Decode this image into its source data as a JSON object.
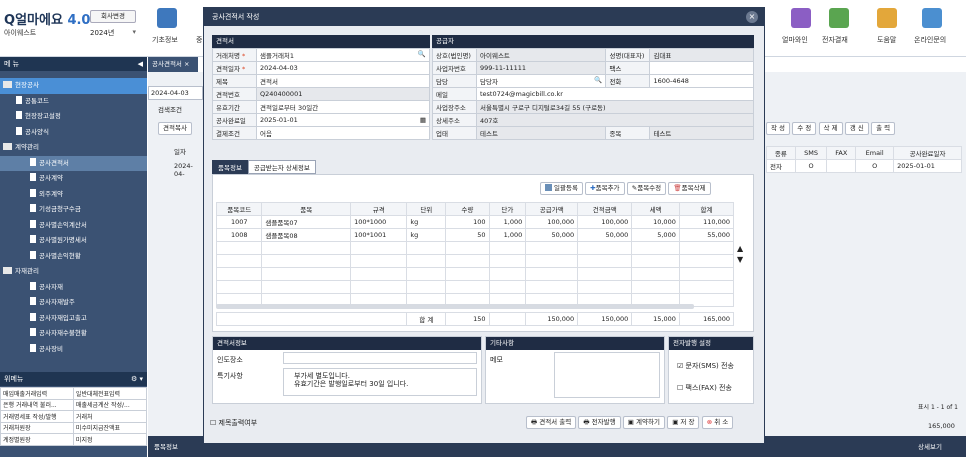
{
  "app": {
    "logo": "얼마에요",
    "version": "4.0",
    "company_btn": "회사변경",
    "company": "아이웨스트",
    "year": "2024년"
  },
  "toolbar": [
    "기초정보",
    "중",
    "얼마와인",
    "전자결재",
    "도움말",
    "온라인문의"
  ],
  "sidebar": {
    "title": "메 뉴",
    "items": [
      {
        "label": "현장공사",
        "level": "cat",
        "state": "sel"
      },
      {
        "label": "공통코드",
        "level": "sub"
      },
      {
        "label": "현장장고설정",
        "level": "sub"
      },
      {
        "label": "공사양식",
        "level": "sub"
      },
      {
        "label": "계약관리",
        "level": "cat"
      },
      {
        "label": "공사견적서",
        "level": "sub2",
        "state": "sel2"
      },
      {
        "label": "공사계약",
        "level": "sub2"
      },
      {
        "label": "외주계약",
        "level": "sub2"
      },
      {
        "label": "기성금청구수금",
        "level": "sub2"
      },
      {
        "label": "공사별손익계산서",
        "level": "sub2"
      },
      {
        "label": "공사별원가명세서",
        "level": "sub2"
      },
      {
        "label": "공사별손익현황",
        "level": "sub2"
      },
      {
        "label": "자재관리",
        "level": "cat"
      },
      {
        "label": "공사자재",
        "level": "sub2"
      },
      {
        "label": "공사자재발주",
        "level": "sub2"
      },
      {
        "label": "공사자재입고출고",
        "level": "sub2"
      },
      {
        "label": "공사자재수불현황",
        "level": "sub2"
      },
      {
        "label": "공사장비",
        "level": "sub2"
      }
    ],
    "fav_title": "위메뉴",
    "fav": [
      [
        "매입매출거래입력",
        "일반대체전표입력"
      ],
      [
        "은행 거래내역 불러...",
        "매출세금계산 작성/..."
      ],
      [
        "거래명세표 작성/발행",
        "거래처"
      ],
      [
        "거래처원장",
        "미수미지급잔액표"
      ],
      [
        "계정별원장",
        "미지정"
      ]
    ]
  },
  "background": {
    "tab": "공사견적서",
    "date": "2024-04-03",
    "search": "검색조건",
    "btn_print": "견적복사",
    "col_date": "일자",
    "row_date": "2024-04-",
    "cols": [
      "종류",
      "SMS",
      "FAX",
      "Email",
      "공사완료일자"
    ],
    "row": [
      "전자",
      "O",
      "",
      "O",
      "2025-01-01"
    ],
    "pager": "표시 1 - 1 of 1",
    "total": "165,000",
    "detail": "상세보기",
    "bottom_tab": "품목정보",
    "actions": [
      "작 성",
      "수 정",
      "삭 제",
      "갱 신",
      "출 력"
    ]
  },
  "modal": {
    "title": "공사견적서 작성",
    "estimate": {
      "title": "견적서",
      "rows": [
        {
          "label": "거래처명",
          "req": true,
          "value": "샘플거래처1"
        },
        {
          "label": "견적일자",
          "req": true,
          "value": "2024-04-03"
        },
        {
          "label": "제목",
          "value": "견적서"
        },
        {
          "label": "견적번호",
          "value": "Q240400001"
        },
        {
          "label": "유효기간",
          "value": "견적일로부터 30일간"
        },
        {
          "label": "공사완료일",
          "value": "2025-01-01"
        },
        {
          "label": "결제조건",
          "value": "어음"
        }
      ]
    },
    "supplier": {
      "title": "공급자",
      "biz_label": "상호(법인명)",
      "biz": "아이웨스트",
      "ceo_label": "성명(대표자)",
      "ceo": "김대표",
      "regno_label": "사업자번호",
      "regno": "999-11-11111",
      "fax_label": "팩스",
      "fax": "",
      "manager_label": "담당",
      "manager": "담당자",
      "tel_label": "전화",
      "tel": "1600-4648",
      "mail_label": "메일",
      "mail": "test0724@magicbill.co.kr",
      "addr_label": "사업장주소",
      "addr": "서울특별시 구로구 디지털로34길 55 (구로동)",
      "addr2_label": "상세주소",
      "addr2": "407호",
      "type_label": "업태",
      "type": "테스트",
      "item_label": "종목",
      "item": "테스트"
    },
    "tabs": [
      "품목정보",
      "공급받는자 상세정보"
    ],
    "item_buttons": [
      "일괄등록",
      "품목추가",
      "품목수정",
      "품목삭제"
    ],
    "grid": {
      "headers": [
        "품목코드",
        "품목",
        "규격",
        "단위",
        "수량",
        "단가",
        "공급가액",
        "건적금액",
        "세액",
        "합계"
      ],
      "rows": [
        [
          "1007",
          "샘플품목07",
          "100*1000",
          "kg",
          "100",
          "1,000",
          "100,000",
          "100,000",
          "10,000",
          "110,000"
        ],
        [
          "1008",
          "샘플품목08",
          "100*1001",
          "kg",
          "50",
          "1,000",
          "50,000",
          "50,000",
          "5,000",
          "55,000"
        ]
      ],
      "total_label": "합 계",
      "totals": [
        "150",
        "",
        "150,000",
        "150,000",
        "15,000",
        "165,000"
      ]
    },
    "info": {
      "title": "견적서정보",
      "place_label": "인도장소",
      "place": "",
      "note_label": "특기사항",
      "note1": "부가세 별도입니다.",
      "note2": "유효기간은 발행일로부터 30일 입니다."
    },
    "etc": {
      "title": "기타사항",
      "memo_label": "메모"
    },
    "send": {
      "title": "전자발행 설정",
      "sms": "문자(SMS) 전송",
      "fax": "팩스(FAX) 전송"
    },
    "footer": {
      "hide_title": "제목출력여부",
      "buttons": [
        "견적서 출력",
        "전자발행",
        "계약하기",
        "저 장",
        "취 소"
      ]
    }
  },
  "colors": {
    "header": "#2b3b55",
    "sidebar": "#3b5273",
    "selected": "#4a8fd6"
  }
}
